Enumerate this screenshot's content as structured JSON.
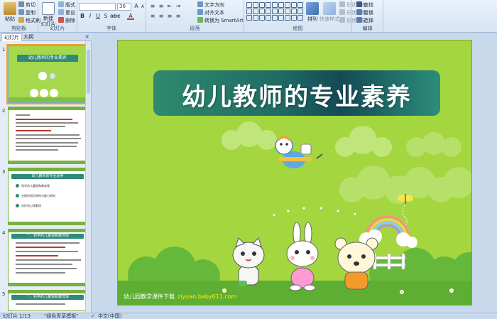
{
  "ribbon": {
    "clipboard": {
      "label": "剪贴板",
      "paste": "粘贴",
      "cut": "剪切",
      "copy": "复制",
      "format_painter": "格式刷"
    },
    "slides": {
      "label": "幻灯片",
      "new_slide": "新建\n幻灯片",
      "layout": "版式",
      "reset": "重设",
      "delete": "删除"
    },
    "font": {
      "label": "字体",
      "font_name": "",
      "font_size": "36"
    },
    "paragraph": {
      "label": "段落",
      "text_direction": "文字方向",
      "align_text": "对齐文本",
      "smartart": "转换为 SmartArt"
    },
    "drawing": {
      "label": "绘图",
      "arrange": "排列",
      "quick_styles": "快速样式",
      "shape_fill": "形状填充",
      "shape_outline": "形状轮廓",
      "shape_effects": "形状效果"
    },
    "editing": {
      "label": "编辑",
      "find": "查找",
      "replace": "替换",
      "select": "选择"
    }
  },
  "pane": {
    "tab_slides": "幻灯片",
    "tab_outline": "大纲",
    "close": "×",
    "thumbnails": [
      {
        "num": "1",
        "title": "幼儿教师的专业素养"
      },
      {
        "num": "2",
        "title": ""
      },
      {
        "num": "3",
        "title": "幼儿教师的专业素养",
        "items": [
          "科学的儿童观和教育观",
          "合理的知识结构与能力结构",
          "良好的心理素质"
        ]
      },
      {
        "num": "4",
        "title": "一、科学的儿童观和教育观"
      },
      {
        "num": "5",
        "title": "一、科学的儿童观和教育观"
      }
    ]
  },
  "slide": {
    "title": "幼儿教师的专业素养",
    "footer": "幼儿园教学课件下载",
    "footer_url": "ziyuan.baby611.com"
  },
  "status": {
    "slide_count": "幻灯片 1/13",
    "theme": "\"绿色青草模板\"",
    "language": "中文(中国)"
  },
  "colors": {
    "slide_bg": "#a4d63f",
    "title_box": "#1f6a64",
    "ribbon": "#dbe7f5",
    "accent_selection": "#f0a030"
  }
}
